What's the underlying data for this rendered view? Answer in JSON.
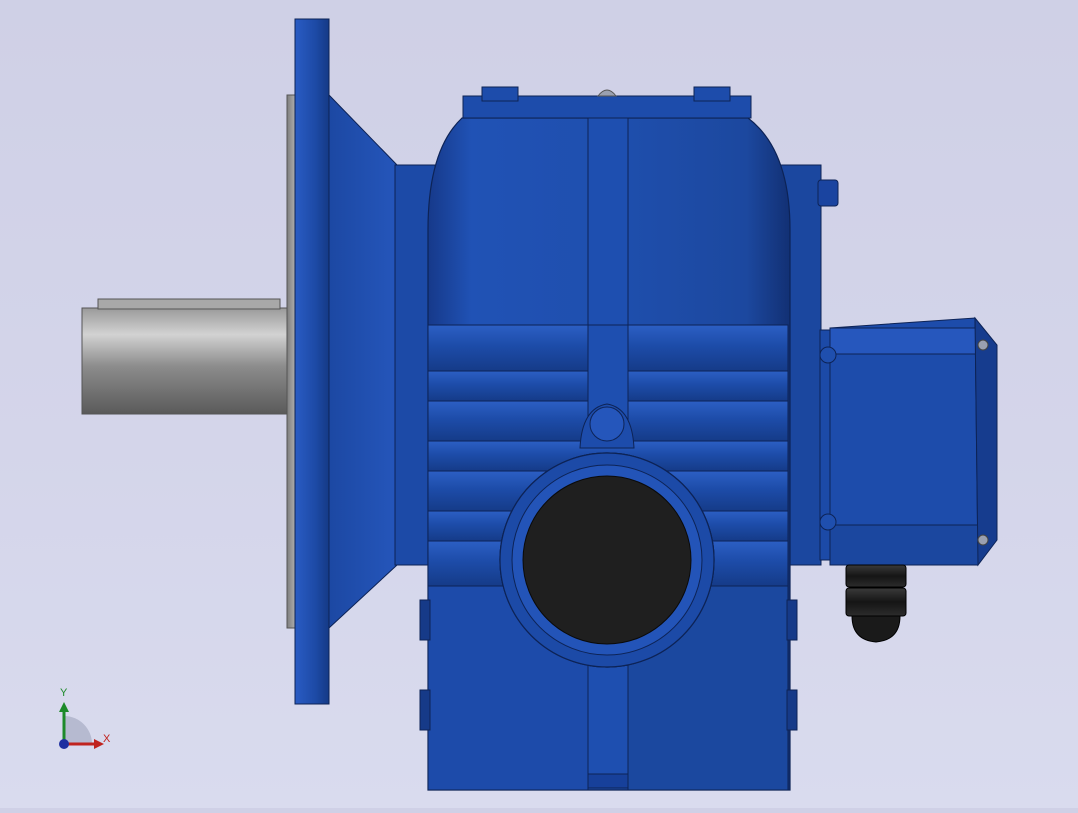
{
  "viewport": {
    "background": "#d3d4e9",
    "model_color": "#1c4aa3",
    "shaft_color": "#8f8f8f",
    "bore_color": "#202020"
  },
  "triad": {
    "x_label": "X",
    "y_label": "Y",
    "x_color": "#c0231e",
    "y_color": "#1d8a2a",
    "z_color": "#1e2fa0"
  }
}
